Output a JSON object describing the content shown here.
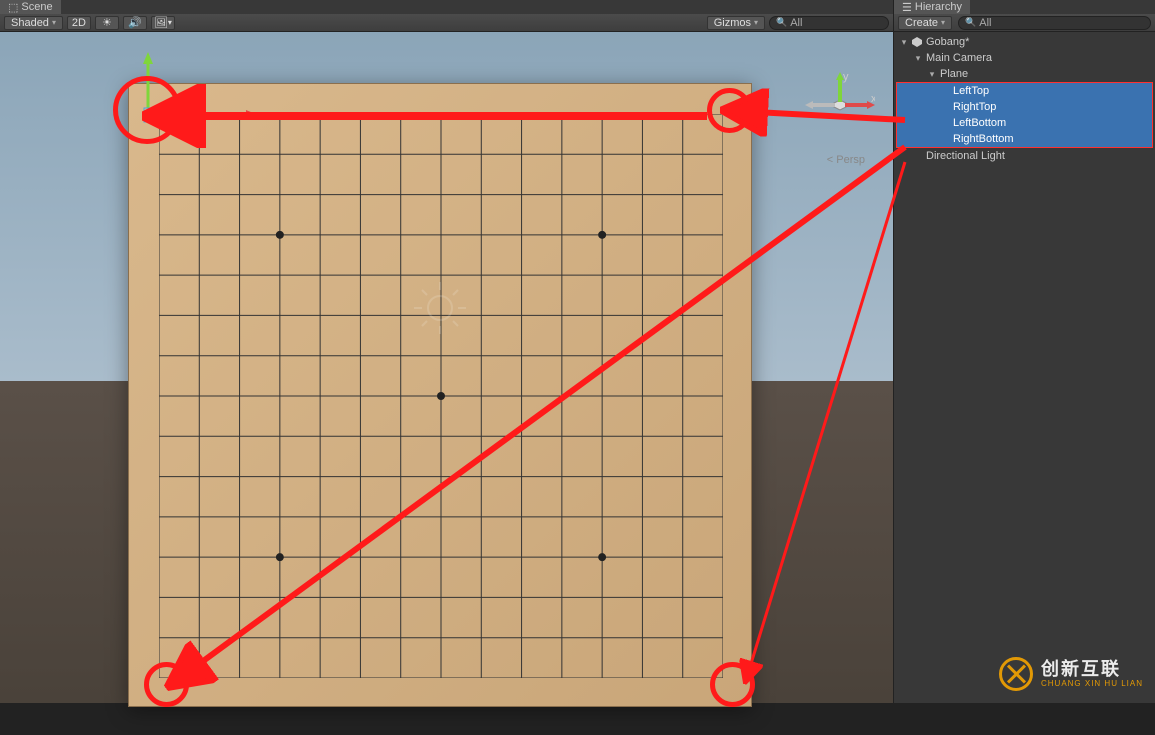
{
  "scene": {
    "tab_label": "Scene",
    "shading_mode": "Shaded",
    "2d_label": "2D",
    "gizmos_label": "Gizmos",
    "search_placeholder": "All",
    "persp_label": "Persp",
    "axis_x": "x",
    "axis_y": "y"
  },
  "hierarchy": {
    "tab_label": "Hierarchy",
    "create_label": "Create",
    "search_placeholder": "All",
    "scene_name": "Gobang*",
    "items": [
      {
        "label": "Main Camera"
      },
      {
        "label": "Plane"
      },
      {
        "label": "LeftTop"
      },
      {
        "label": "RightTop"
      },
      {
        "label": "LeftBottom"
      },
      {
        "label": "RightBottom"
      },
      {
        "label": "Directional Light"
      }
    ]
  },
  "watermark": {
    "cn": "创新互联",
    "py": "CHUANG XIN HU LIAN"
  },
  "annotations": {
    "color": "#ff1a1a"
  }
}
